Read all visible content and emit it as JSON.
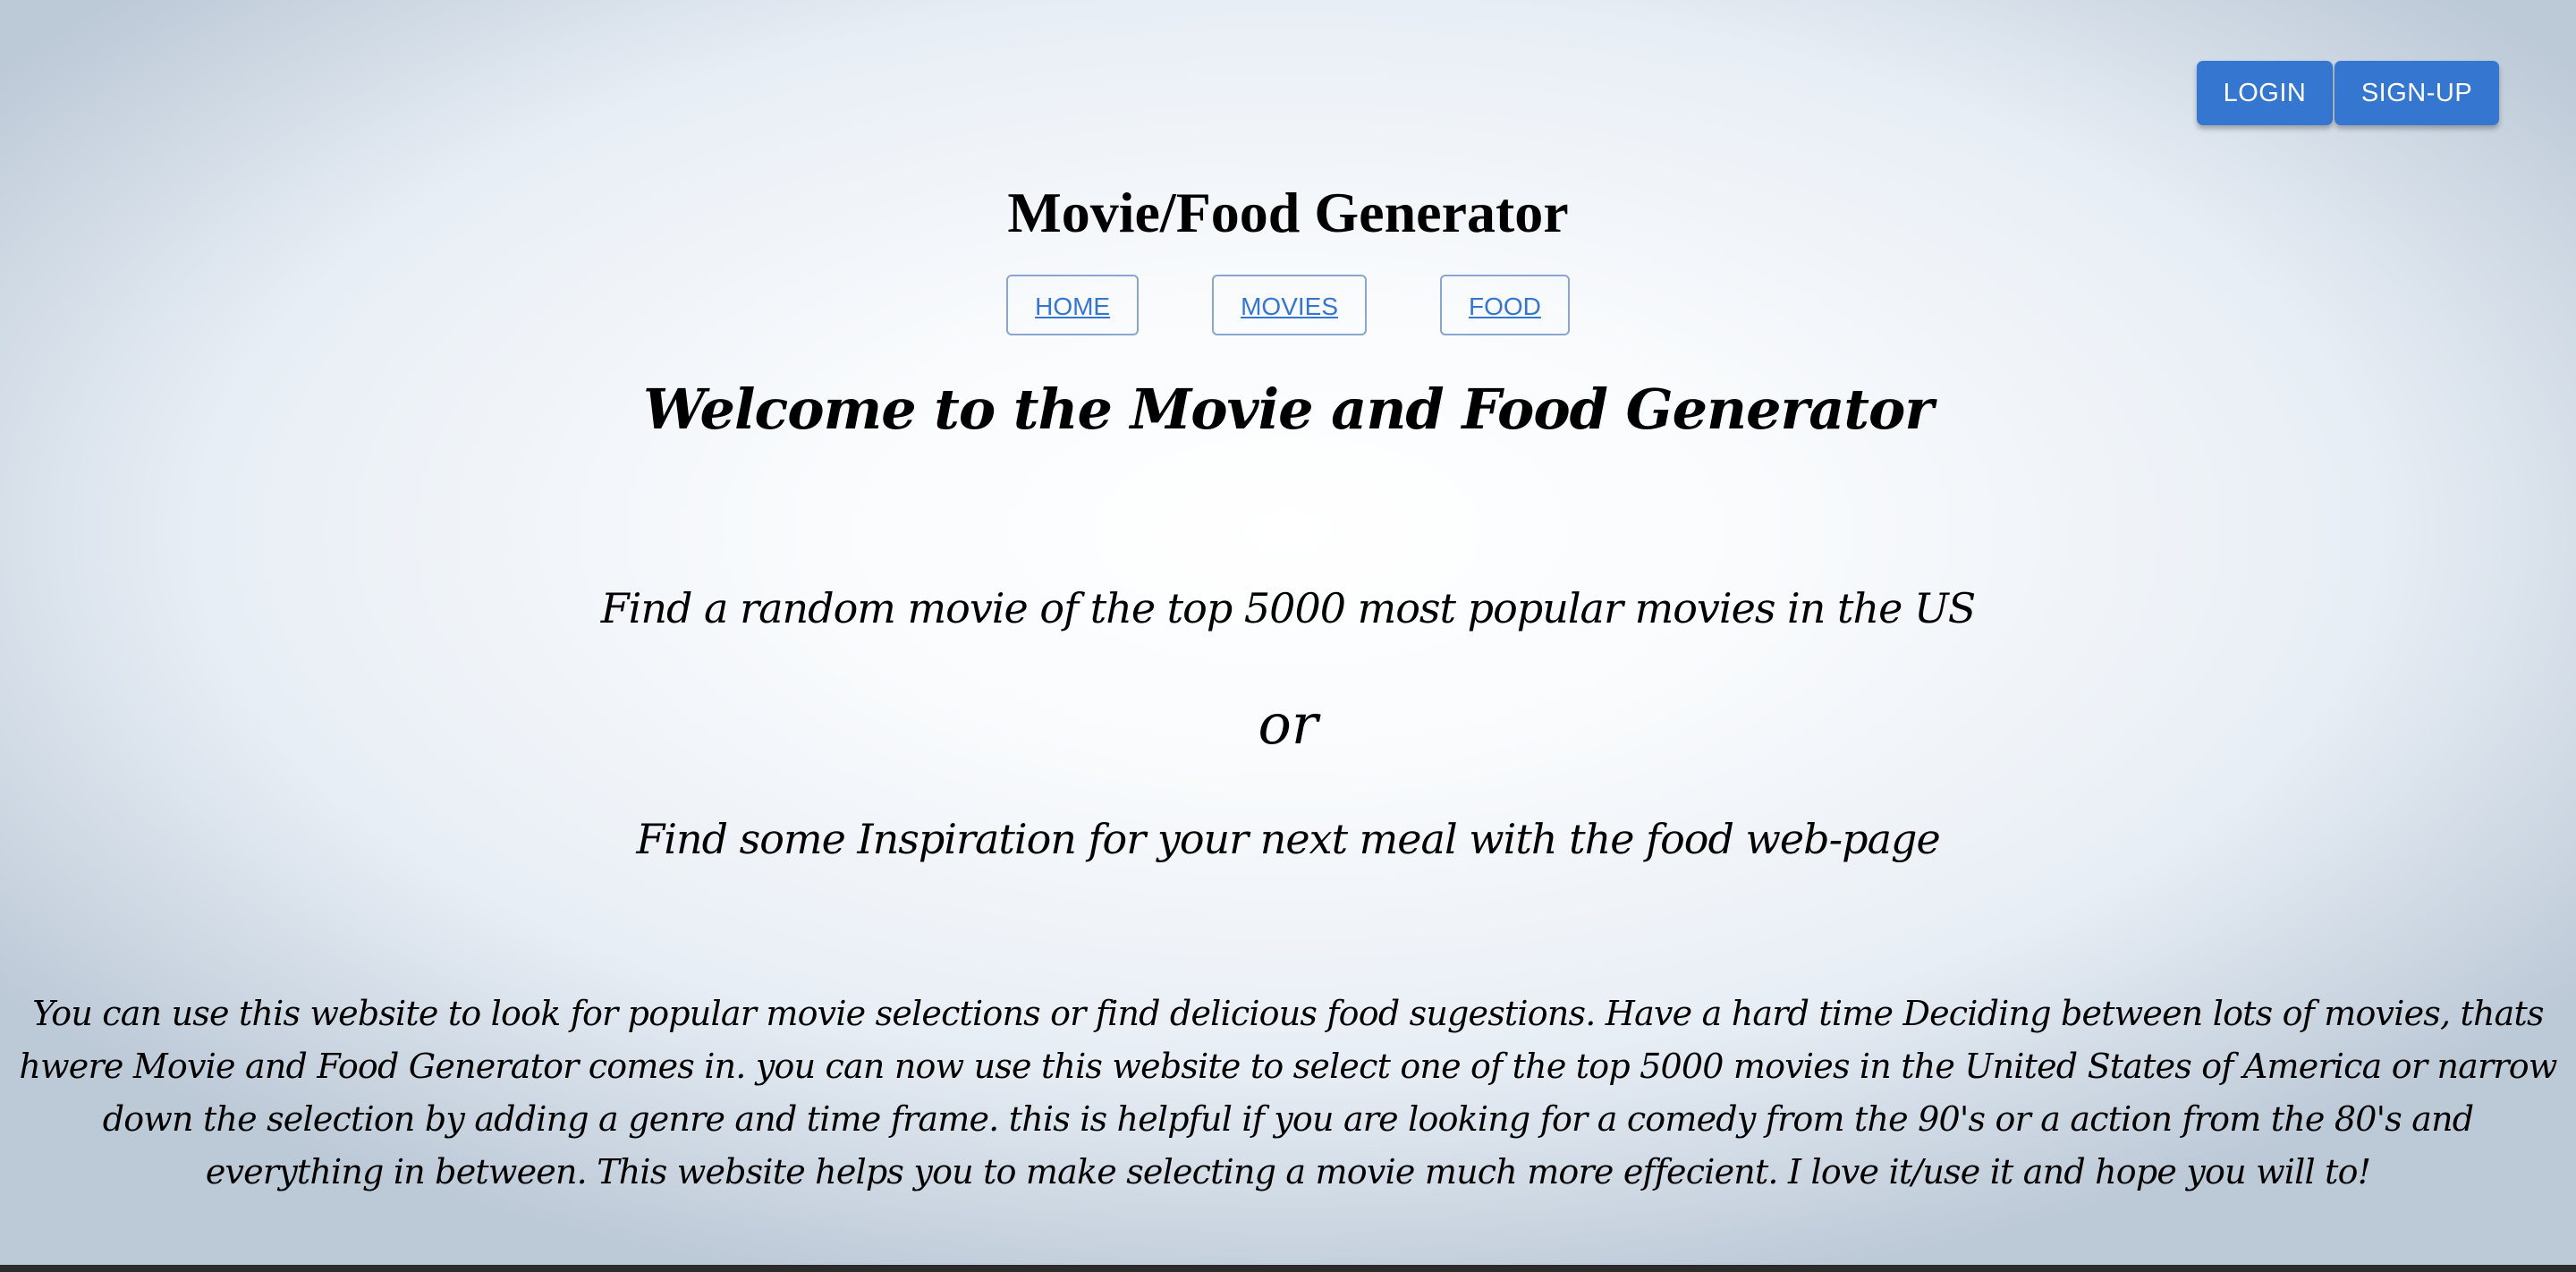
{
  "header": {
    "login_label": "LOGIN",
    "signup_label": "SIGN-UP"
  },
  "site_title": "Movie/Food Generator",
  "nav": {
    "home": "HOME",
    "movies": "MOVIES",
    "food": "FOOD"
  },
  "main": {
    "welcome": "Welcome to the Movie and Food Generator",
    "line1": "Find a random movie of the top 5000 most popular movies in the US",
    "or": "or",
    "line2": "Find some Inspiration for your next meal with the food web-page",
    "description": "You can use this website to look for popular movie selections or find delicious food sugestions. Have a hard time Deciding between lots of movies, thats hwere Movie and Food Generator comes in. you can now use this website to select one of the top 5000 movies in the United States of America or narrow down the selection by adding a genre and time frame. this is helpful if you are looking for a comedy from the 90's or a action from the 80's and everything in between. This website helps you to make selecting a movie much more effecient. I love it/use it and hope you will to!"
  },
  "colors": {
    "accent": "#3576d1",
    "nav_border": "#8aa6d0",
    "text": "#000000"
  }
}
